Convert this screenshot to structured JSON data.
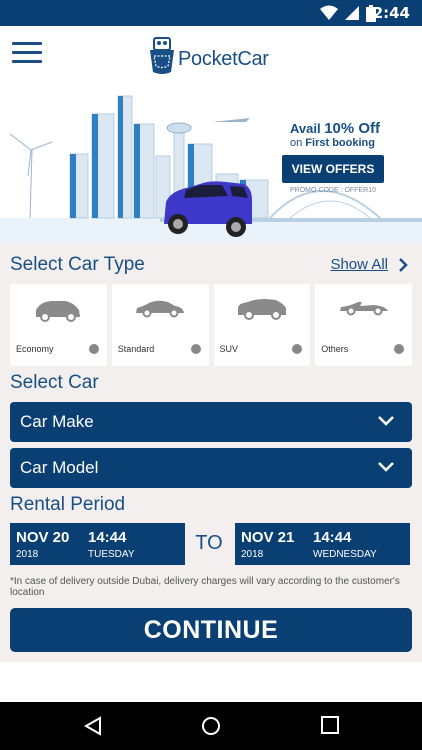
{
  "status_bar": {
    "time": "2:44"
  },
  "header": {
    "brand_pocket": "Pocket",
    "brand_car": "Car"
  },
  "offer": {
    "line1_prefix": "Avail ",
    "line1_highlight": "10% Off",
    "line2_prefix": "on ",
    "line2_bold": "First booking",
    "button": "VIEW OFFERS",
    "promo": "PROMO CODE : OFFER10"
  },
  "car_type": {
    "title": "Select Car Type",
    "show_all": "Show All",
    "types": [
      {
        "label": "Economy"
      },
      {
        "label": "Standard"
      },
      {
        "label": "SUV"
      },
      {
        "label": "Others"
      }
    ]
  },
  "select_car": {
    "title": "Select Car",
    "make": "Car Make",
    "model": "Car Model"
  },
  "rental": {
    "title": "Rental Period",
    "start": {
      "date": "NOV 20",
      "time": "14:44",
      "year": "2018",
      "weekday": "TUESDAY"
    },
    "to": "TO",
    "end": {
      "date": "NOV 21",
      "time": "14:44",
      "year": "2018",
      "weekday": "WEDNESDAY"
    }
  },
  "note": "*In case of delivery outside Dubai, delivery charges will vary according to the customer's location",
  "continue_label": "CONTINUE",
  "colors": {
    "primary": "#0a3f73",
    "background": "#f2efee",
    "accent_text": "#1a4f86",
    "car": "#3d38c9"
  }
}
